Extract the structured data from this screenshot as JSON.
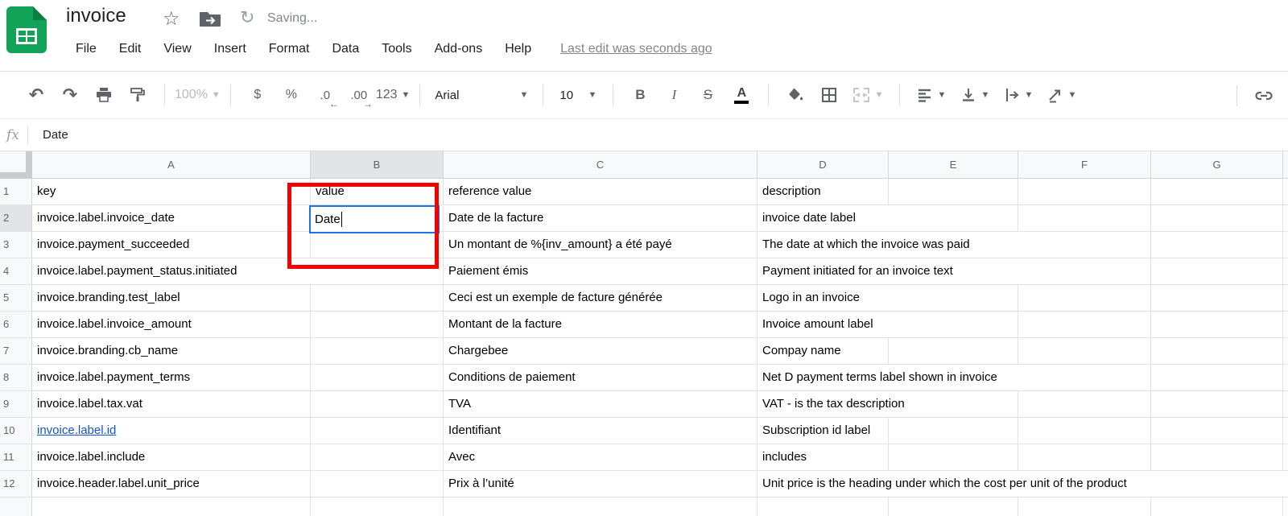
{
  "titlebar": {
    "title": "invoice",
    "saving": "Saving...",
    "menu": [
      "File",
      "Edit",
      "View",
      "Insert",
      "Format",
      "Data",
      "Tools",
      "Add-ons",
      "Help"
    ],
    "last_edit": "Last edit was seconds ago"
  },
  "toolbar": {
    "zoom": "100%",
    "currency": "$",
    "percent": "%",
    "decrease_decimal": ".0",
    "increase_decimal": ".00",
    "number_format": "123",
    "font_name": "Arial",
    "font_size": "10",
    "bold": "B",
    "italic": "I",
    "strikethrough": "S",
    "text_color": "A"
  },
  "formula_bar": {
    "fx": "fx",
    "value": "Date"
  },
  "grid": {
    "columns": [
      "A",
      "B",
      "C",
      "D",
      "E",
      "F",
      "G"
    ],
    "active_cell": {
      "ref": "B2",
      "value": "Date"
    },
    "rows": [
      {
        "n": "1",
        "A": "key",
        "B": "value",
        "C": "reference value",
        "D": "description"
      },
      {
        "n": "2",
        "A": "invoice.label.invoice_date",
        "B": "",
        "C": "Date de la facture",
        "D": "invoice date label"
      },
      {
        "n": "3",
        "A": "invoice.payment_succeeded",
        "B": "",
        "C": "Un montant de %{inv_amount} a été payé",
        "D": "The date at which the invoice was paid"
      },
      {
        "n": "4",
        "A": "invoice.label.payment_status.initiated",
        "B": "",
        "C": "Paiement émis",
        "D": "Payment initiated for an invoice text"
      },
      {
        "n": "5",
        "A": "invoice.branding.test_label",
        "B": "",
        "C": "Ceci est un exemple de facture générée",
        "D": "Logo in an invoice"
      },
      {
        "n": "6",
        "A": "invoice.label.invoice_amount",
        "B": "",
        "C": "Montant de la facture",
        "D": "Invoice amount label"
      },
      {
        "n": "7",
        "A": "invoice.branding.cb_name",
        "B": "",
        "C": "Chargebee",
        "D": "Compay name"
      },
      {
        "n": "8",
        "A": "invoice.label.payment_terms",
        "B": "",
        "C": "Conditions de paiement",
        "D": "Net D payment terms label shown in invoice"
      },
      {
        "n": "9",
        "A": "invoice.label.tax.vat",
        "B": "",
        "C": "TVA",
        "D": "VAT -  is the tax description"
      },
      {
        "n": "10",
        "A": "invoice.label.id",
        "B": "",
        "C": "Identifiant",
        "D": "Subscription id label",
        "a_link": true
      },
      {
        "n": "11",
        "A": "invoice.label.include",
        "B": "",
        "C": "Avec",
        "D": "includes"
      },
      {
        "n": "12",
        "A": "invoice.header.label.unit_price",
        "B": "",
        "C": "Prix à l’unité",
        "D": "Unit price is the heading under which the cost per unit of the product"
      }
    ]
  },
  "colors": {
    "accent_blue": "#1a73e8",
    "annotation_red": "#f50000",
    "link_blue": "#1155cc",
    "logo_green": "#12a358"
  }
}
